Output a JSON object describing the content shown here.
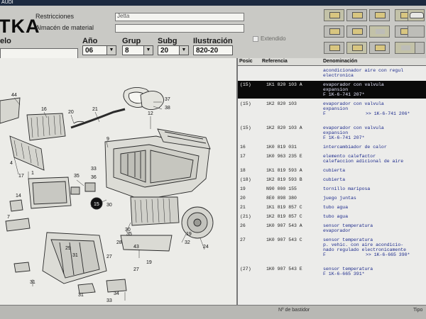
{
  "window_title": "AUDI",
  "brand": "TKA",
  "header": {
    "restricciones_label": "Restricciones",
    "restricciones_value": "Jetta",
    "almacen_label": "Almacén de material",
    "modelo_label": "elo",
    "ano_label": "Año",
    "ano_value": "06",
    "grup_label": "Grup",
    "grup_value": "8",
    "subg_label": "Subg",
    "subg_value": "20",
    "ilustracion_label": "Ilustración",
    "ilustracion_value": "820-20",
    "extendido_label": "Extendido",
    "dropdown_arrow": "▼"
  },
  "toolbar_icons": [
    "folder-icon",
    "folder-stack-icon",
    "print-icon",
    "arrow-left-icon",
    "folder-icon",
    "folder-stack-icon",
    "blank-panel-icon",
    "document-icon",
    "arrow-left-icon",
    "arrow-right-icon",
    "folder-icon",
    "wrench-icon",
    "car-icon",
    "blank-panel-icon",
    "blank-panel-icon",
    "blank-panel-icon"
  ],
  "columns": {
    "posic": "Posic",
    "referencia": "Referencia",
    "denominacion": "Denominación"
  },
  "parts": [
    {
      "pos": "",
      "ref": "",
      "desc": [
        "acondicionador aire con regul",
        "electronica"
      ],
      "note": "",
      "selected": false
    },
    {
      "pos": "(15)",
      "ref": "1K1 820 103 A",
      "desc": [
        "evaporador con valvula",
        "expansion",
        "F 1K-6-741 207*"
      ],
      "note": "",
      "selected": true
    },
    {
      "pos": "(15)",
      "ref": "1K2 820 103",
      "desc": [
        "evaporador con valvula",
        "expansion",
        "F"
      ],
      "note": ">> 1K-6-741 206*",
      "selected": false
    },
    {
      "pos": "(15)",
      "ref": "1K2 820 103 A",
      "desc": [
        "evaporador con valvula",
        "expansion",
        "F 1K-6-741 207*"
      ],
      "note": "",
      "selected": false
    },
    {
      "pos": "16",
      "ref": "1K0 819 031",
      "desc": [
        "intercambiador de calor"
      ],
      "note": "",
      "selected": false
    },
    {
      "pos": "17",
      "ref": "1K0 963 235 E",
      "desc": [
        "elemento calefactor",
        "calefaccion adicional de aire"
      ],
      "note": "",
      "selected": false
    },
    {
      "pos": "18",
      "ref": "1K1 819 593 A",
      "desc": [
        "cubierta"
      ],
      "note": "",
      "selected": false
    },
    {
      "pos": "(18)",
      "ref": "1K2 819 593 B",
      "desc": [
        "cubierta"
      ],
      "note": "",
      "selected": false
    },
    {
      "pos": "19",
      "ref": "N90 000 155",
      "desc": [
        "tornillo mariposa"
      ],
      "note": "",
      "selected": false
    },
    {
      "pos": "20",
      "ref": "8E0 898 380",
      "desc": [
        "juego juntas"
      ],
      "note": "",
      "selected": false
    },
    {
      "pos": "21",
      "ref": "1K1 819 857 C",
      "desc": [
        "tubo agua"
      ],
      "note": "",
      "selected": false
    },
    {
      "pos": "(21)",
      "ref": "1K2 819 857 C",
      "desc": [
        "tubo agua"
      ],
      "note": "",
      "selected": false
    },
    {
      "pos": "26",
      "ref": "1K0 907 543 A",
      "desc": [
        "sensor temperatura",
        "evaporador"
      ],
      "note": "",
      "selected": false
    },
    {
      "pos": "27",
      "ref": "1K0 907 543 C",
      "desc": [
        "sensor temperatura",
        "p. vehic. con aire acondicio-",
        "nado regulado electronicamente",
        "F"
      ],
      "note": ">> 1K-6-665 390*",
      "selected": false
    },
    {
      "pos": "(27)",
      "ref": "1K0 907 543 E",
      "desc": [
        "sensor temperatura",
        "F 1K-6-665 391*"
      ],
      "note": "",
      "selected": false
    }
  ],
  "diagram_labels": [
    "44",
    "16",
    "20",
    "21",
    "9",
    "37",
    "38",
    "12",
    "17",
    "4",
    "35",
    "36",
    "33",
    "28",
    "29",
    "31",
    "14",
    "30",
    "15",
    "30",
    "7",
    "1",
    "35",
    "43",
    "32",
    "19",
    "27",
    "31",
    "33",
    "27",
    "34",
    "31",
    "19",
    "24"
  ],
  "status": {
    "bastidor_label": "Nº de bastidor",
    "right_label": "Tipo"
  }
}
